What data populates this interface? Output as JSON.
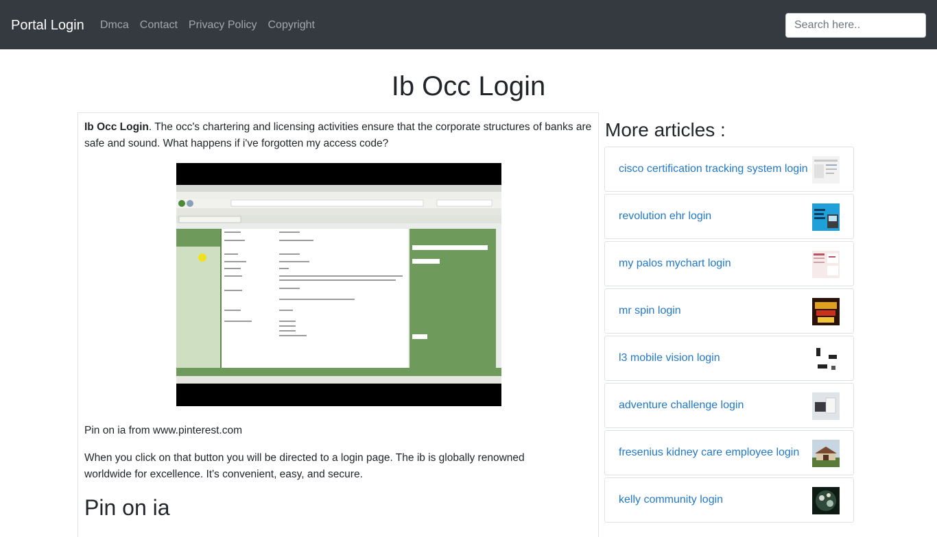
{
  "nav": {
    "brand": "Portal Login",
    "links": [
      "Dmca",
      "Contact",
      "Privacy Policy",
      "Copyright"
    ],
    "search_placeholder": "Search here.."
  },
  "page": {
    "title": "Ib Occ Login"
  },
  "article": {
    "intro_bold": "Ib Occ Login",
    "intro_text": ". The occ's chartering and licensing activities ensure that the corporate structures of banks are safe and sound. What happens if i've forgotten my access code?",
    "image_caption": "Pin on ia from www.pinterest.com",
    "paragraph2": "When you click on that button you will be directed to a login page. The ib is globally renowned worldwide for excellence. It's convenient, easy, and secure.",
    "heading2": "Pin on ia"
  },
  "sidebar": {
    "title": "More articles :",
    "items": [
      {
        "label": "cisco certification tracking system login"
      },
      {
        "label": "revolution ehr login"
      },
      {
        "label": "my palos mychart login"
      },
      {
        "label": "mr spin login"
      },
      {
        "label": "l3 mobile vision login"
      },
      {
        "label": "adventure challenge login"
      },
      {
        "label": "fresenius kidney care employee login"
      },
      {
        "label": "kelly community login"
      }
    ]
  },
  "colors": {
    "navbar_bg": "#343a40",
    "link": "#2178c8",
    "border": "#dee2e6"
  }
}
